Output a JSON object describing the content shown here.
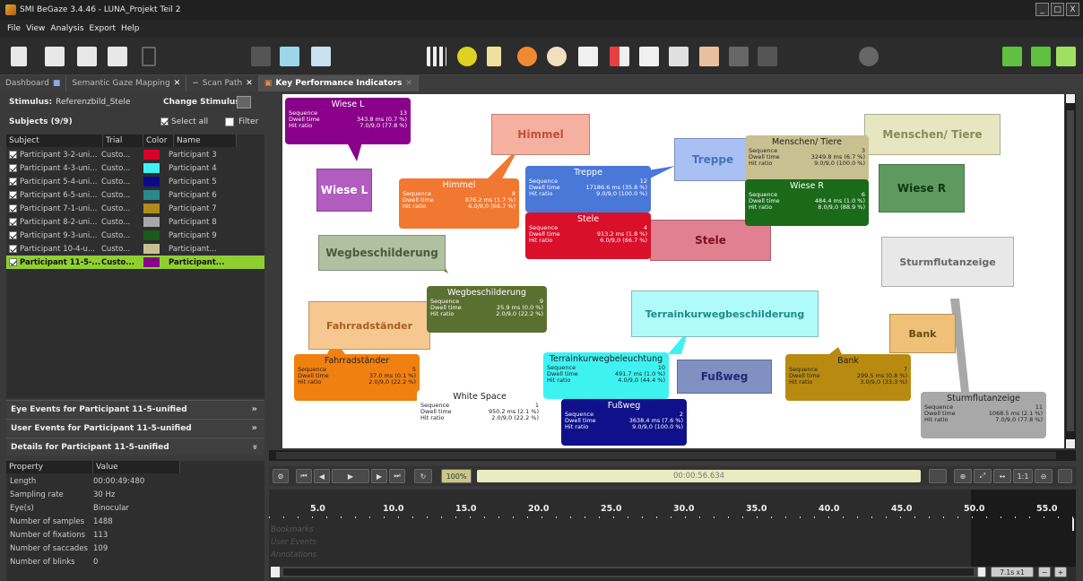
{
  "window": {
    "title": "SMI BeGaze 3.4.46 - LUNA_Projekt Teil 2",
    "controls": [
      "_",
      "□",
      "X"
    ]
  },
  "menu": [
    "File",
    "View",
    "Analysis",
    "Export",
    "Help"
  ],
  "tabs": [
    {
      "label": "Dashboard",
      "active": false
    },
    {
      "label": "Semantic Gaze Mapping",
      "active": false
    },
    {
      "label": "Scan Path",
      "active": false
    },
    {
      "label": "Key Performance Indicators",
      "active": true
    }
  ],
  "left": {
    "stimulus_label": "Stimulus:",
    "stimulus_value": "Referenzbild_Stele",
    "change_stimulus": "Change Stimulus:",
    "subjects_title": "Subjects (9/9)",
    "select_all": "Select all",
    "filter": "Filter",
    "columns": [
      "Subject",
      "Trial",
      "Color",
      "Name"
    ],
    "subjects": [
      {
        "subject": "Participant 3-2-uni...",
        "trial": "Custo...",
        "color": "#d8002a",
        "name": "Participant 3"
      },
      {
        "subject": "Participant 4-3-uni...",
        "trial": "Custo...",
        "color": "#3ef2f2",
        "name": "Participant 4"
      },
      {
        "subject": "Participant 5-4-uni...",
        "trial": "Custo...",
        "color": "#0a0a8c",
        "name": "Participant 5"
      },
      {
        "subject": "Participant 6-5-uni...",
        "trial": "Custo...",
        "color": "#2a8a8a",
        "name": "Participant 6"
      },
      {
        "subject": "Participant 7-1-uni...",
        "trial": "Custo...",
        "color": "#b08a1a",
        "name": "Participant 7"
      },
      {
        "subject": "Participant 8-2-uni...",
        "trial": "Custo...",
        "color": "#a8a8a8",
        "name": "Participant 8"
      },
      {
        "subject": "Participant 9-3-uni...",
        "trial": "Custo...",
        "color": "#1a5a1a",
        "name": "Participant 9"
      },
      {
        "subject": "Participant 10-4-u...",
        "trial": "Custo...",
        "color": "#c8c090",
        "name": "Participant..."
      },
      {
        "subject": "Participant 11-5-...",
        "trial": "Custo...",
        "color": "#8a008a",
        "name": "Participant..."
      }
    ],
    "sections": [
      {
        "label": "Eye Events for Participant 11-5-unified",
        "chevron": "»"
      },
      {
        "label": "User Events for Participant 11-5-unified",
        "chevron": "»"
      },
      {
        "label": "Details for Participant 11-5-unified",
        "chevron": "»"
      }
    ],
    "prop_columns": [
      "Property",
      "Value"
    ],
    "properties": [
      {
        "k": "Length",
        "v": "00:00:49:480"
      },
      {
        "k": "Sampling rate",
        "v": "30 Hz"
      },
      {
        "k": "Eye(s)",
        "v": "Binocular"
      },
      {
        "k": "Number of samples",
        "v": "1488"
      },
      {
        "k": "Number of fixations",
        "v": "113"
      },
      {
        "k": "Number of saccades",
        "v": "109"
      },
      {
        "k": "Number of blinks",
        "v": "0"
      }
    ]
  },
  "labels": {
    "seq": "Sequence",
    "dwell": "Dwell time",
    "hit": "Hit ratio"
  },
  "aois": [
    {
      "id": "wiese-l",
      "label": "Wiese L",
      "bg": "#b25cc0",
      "color": "#fff",
      "fs": 12
    },
    {
      "id": "himmel",
      "label": "Himmel",
      "bg": "#f6b0a0",
      "color": "#c0503c",
      "fs": 12
    },
    {
      "id": "treppe",
      "label": "Treppe",
      "bg": "#a8c0f4",
      "color": "#4a70b8",
      "fs": 12
    },
    {
      "id": "menschen",
      "label": "Menschen/ Tiere",
      "bg": "#e6e6c0",
      "color": "#8a8a5a",
      "fs": 12
    },
    {
      "id": "wiese-r",
      "label": "Wiese R",
      "bg": "#5e9a60",
      "color": "#0a3a0a",
      "fs": 12
    },
    {
      "id": "stele",
      "label": "Stele",
      "bg": "#e08090",
      "color": "#7a1020",
      "fs": 12
    },
    {
      "id": "wegbesch",
      "label": "Wegbeschilderung",
      "bg": "#b0c0a0",
      "color": "#4a5a3a",
      "fs": 12
    },
    {
      "id": "sturm",
      "label": "Sturmflutanzeige",
      "bg": "#e8e8e8",
      "color": "#666",
      "fs": 11
    },
    {
      "id": "terrain",
      "label": "Terrainkurwegbeschilderung",
      "bg": "#b0fafa",
      "color": "#208a8a",
      "fs": 11
    },
    {
      "id": "fahrrad",
      "label": "Fahrradständer",
      "bg": "#f6c890",
      "color": "#a86020",
      "fs": 11
    },
    {
      "id": "bank",
      "label": "Bank",
      "bg": "#eec078",
      "color": "#6a4a10",
      "fs": 11
    },
    {
      "id": "fussweg",
      "label": "Fußweg",
      "bg": "#8090c0",
      "color": "#1a2a7a",
      "fs": 12
    }
  ],
  "kpis": [
    {
      "id": "wiese-l",
      "title": "Wiese L",
      "bg": "#8a008a",
      "seq": "13",
      "dwell": "343.8 ms (0.7 %)",
      "hit": "7.0/9,0 (77.8 %)"
    },
    {
      "id": "himmel",
      "title": "Himmel",
      "bg": "#f07830",
      "seq": "8",
      "dwell": "876.2 ms (1.7 %)",
      "hit": "6.0/9,0 (66.7 %)"
    },
    {
      "id": "treppe",
      "title": "Treppe",
      "bg": "#4a78d8",
      "seq": "12",
      "dwell": "17186.6 ms (35.8 %)",
      "hit": "9.0/9,0 (100.0 %)"
    },
    {
      "id": "menschen",
      "title": "Menschen/ Tiere",
      "bg": "#c8c090",
      "fg": "#222",
      "seq": "3",
      "dwell": "3249.8 ms (6.7 %)",
      "hit": "9.0/9,0 (100.0 %)"
    },
    {
      "id": "wiese-r",
      "title": "Wiese R",
      "bg": "#1a6a1a",
      "seq": "6",
      "dwell": "484.4 ms (1.0 %)",
      "hit": "8.0/9,0 (88.9 %)"
    },
    {
      "id": "stele",
      "title": "Stele",
      "bg": "#d8102a",
      "seq": "4",
      "dwell": "913.2 ms (1.8 %)",
      "hit": "6.0/9,0 (66.7 %)"
    },
    {
      "id": "wegbesch",
      "title": "Wegbeschilderung",
      "bg": "#5a7030",
      "seq": "9",
      "dwell": "25.9 ms (0.0 %)",
      "hit": "2.0/9,0 (22.2 %)"
    },
    {
      "id": "fahrrad",
      "title": "Fahrradständer",
      "bg": "#f08010",
      "fg": "#222",
      "seq": "5",
      "dwell": "37.0 ms (0.1 %)",
      "hit": "2.0/9,0 (22.2 %)"
    },
    {
      "id": "white",
      "title": "White Space",
      "bg": "#ffffff",
      "fg": "#222",
      "seq": "1",
      "dwell": "950.2 ms (2.1 %)",
      "hit": "2.0/9,0 (22.2 %)"
    },
    {
      "id": "terrain",
      "title": "Terrainkurwegbeleuchtung",
      "bg": "#3ef2f2",
      "fg": "#222",
      "seq": "10",
      "dwell": "491.7 ms (1.0 %)",
      "hit": "4.0/9,0 (44.4 %)"
    },
    {
      "id": "fussweg",
      "title": "Fußweg",
      "bg": "#10108a",
      "seq": "2",
      "dwell": "3638.4 ms (7.6 %)",
      "hit": "9.0/9,0 (100.0 %)"
    },
    {
      "id": "bank",
      "title": "Bank",
      "bg": "#b88a10",
      "fg": "#222",
      "seq": "7",
      "dwell": "299.5 ms (0.8 %)",
      "hit": "3.0/9,0 (33.3 %)"
    },
    {
      "id": "sturm",
      "title": "Sturmflutanzeige",
      "bg": "#a8a8a8",
      "fg": "#222",
      "seq": "11",
      "dwell": "1068.5 ms (2.1 %)",
      "hit": "7.0/9,0 (77.8 %)"
    }
  ],
  "player": {
    "zoom": "100%",
    "time": "00:00:56.634",
    "speed": "7.1s x1",
    "zoom_fit": "1:1"
  },
  "timeline": {
    "ticks": [
      "5.0",
      "10.0",
      "15.0",
      "20.0",
      "25.0",
      "30.0",
      "35.0",
      "40.0",
      "45.0",
      "50.0",
      "55.0"
    ],
    "lanes": [
      "Bookmarks",
      "User Events",
      "Annotations"
    ]
  }
}
